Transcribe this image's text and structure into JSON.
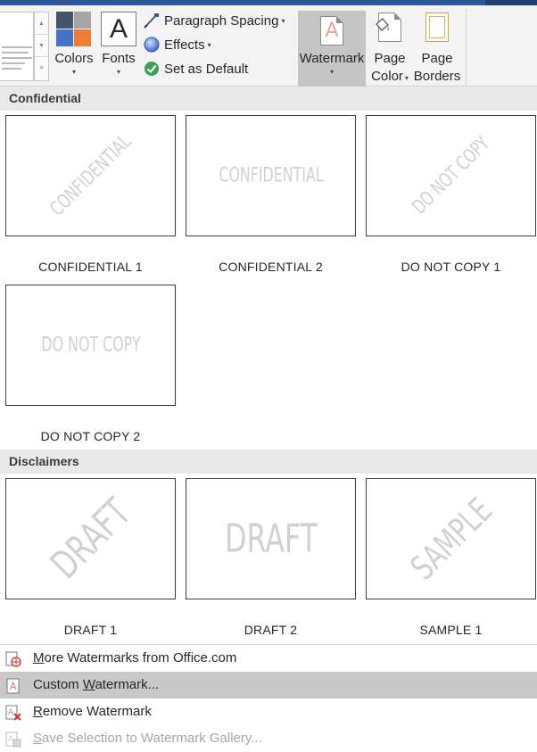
{
  "ribbon": {
    "colors_label": "Colors",
    "fonts_label": "Fonts",
    "fonts_glyph": "A",
    "paragraph_spacing_label": "Paragraph Spacing",
    "effects_label": "Effects",
    "set_as_default_label": "Set as Default",
    "watermark_label": "Watermark",
    "watermark_glyph": "A",
    "page_color_label_1": "Page",
    "page_color_label_2": "Color",
    "page_borders_label_1": "Page",
    "page_borders_label_2": "Borders",
    "dropdown_arrow": "▾",
    "theme_colors": [
      "#44546a",
      "#a5a5a5",
      "#4472c4",
      "#ed7d31"
    ],
    "accent": "#2b579a"
  },
  "gallery": {
    "sections": [
      {
        "header": "Confidential",
        "tiles": [
          {
            "label": "CONFIDENTIAL 1",
            "watermark": "CONFIDENTIAL",
            "layout": "diagonal"
          },
          {
            "label": "CONFIDENTIAL 2",
            "watermark": "CONFIDENTIAL",
            "layout": "horizontal"
          },
          {
            "label": "DO NOT COPY 1",
            "watermark": "DO NOT COPY",
            "layout": "diagonal"
          },
          {
            "label": "DO NOT COPY 2",
            "watermark": "DO NOT COPY",
            "layout": "horizontal"
          }
        ]
      },
      {
        "header": "Disclaimers",
        "tiles": [
          {
            "label": "DRAFT 1",
            "watermark": "DRAFT",
            "layout": "diagonal"
          },
          {
            "label": "DRAFT 2",
            "watermark": "DRAFT",
            "layout": "horizontal"
          },
          {
            "label": "SAMPLE 1",
            "watermark": "SAMPLE",
            "layout": "diagonal"
          }
        ]
      }
    ]
  },
  "menu": {
    "items": [
      {
        "accel": "M",
        "rest": "ore Watermarks from Office.com",
        "icon": "globe-watermark-icon",
        "state": "normal"
      },
      {
        "pre": "Custom ",
        "accel": "W",
        "rest": "atermark...",
        "icon": "custom-watermark-icon",
        "state": "hover"
      },
      {
        "accel": "R",
        "rest": "emove Watermark",
        "icon": "remove-watermark-icon",
        "state": "normal"
      },
      {
        "accel": "S",
        "rest": "ave Selection to Watermark Gallery...",
        "icon": "save-selection-icon",
        "state": "disabled"
      }
    ]
  }
}
